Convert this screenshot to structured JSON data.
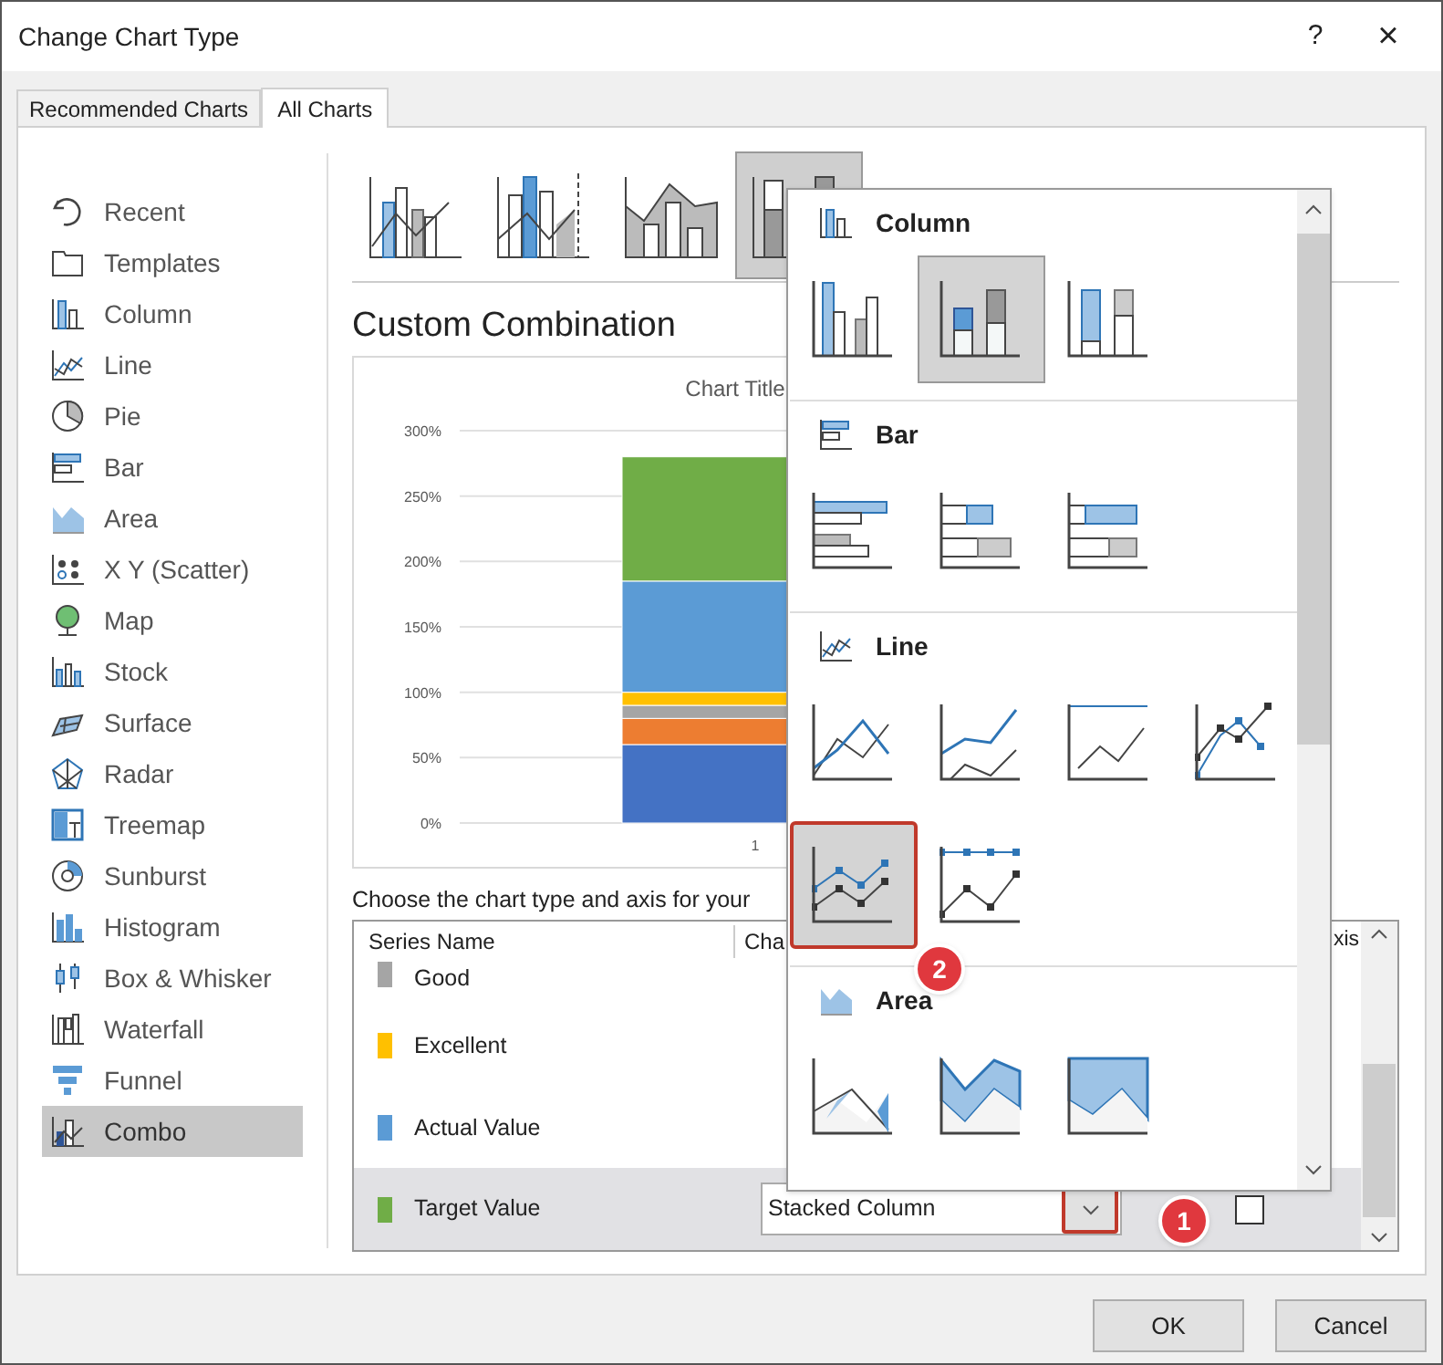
{
  "window": {
    "title": "Change Chart Type",
    "help": "?",
    "close": "×"
  },
  "tabs": [
    {
      "label": "Recommended Charts",
      "selected": false
    },
    {
      "label": "All Charts",
      "selected": true
    }
  ],
  "sidebar": {
    "items": [
      {
        "label": "Recent",
        "selected": false
      },
      {
        "label": "Templates",
        "selected": false
      },
      {
        "label": "Column",
        "selected": false
      },
      {
        "label": "Line",
        "selected": false
      },
      {
        "label": "Pie",
        "selected": false
      },
      {
        "label": "Bar",
        "selected": false
      },
      {
        "label": "Area",
        "selected": false
      },
      {
        "label": "X Y (Scatter)",
        "selected": false
      },
      {
        "label": "Map",
        "selected": false
      },
      {
        "label": "Stock",
        "selected": false
      },
      {
        "label": "Surface",
        "selected": false
      },
      {
        "label": "Radar",
        "selected": false
      },
      {
        "label": "Treemap",
        "selected": false
      },
      {
        "label": "Sunburst",
        "selected": false
      },
      {
        "label": "Histogram",
        "selected": false
      },
      {
        "label": "Box & Whisker",
        "selected": false
      },
      {
        "label": "Waterfall",
        "selected": false
      },
      {
        "label": "Funnel",
        "selected": false
      },
      {
        "label": "Combo",
        "selected": true
      }
    ]
  },
  "combo_types": [
    {
      "selected": false
    },
    {
      "selected": false
    },
    {
      "selected": false
    },
    {
      "selected": true
    }
  ],
  "heading": "Custom Combination",
  "preview": {
    "chart_data": {
      "type": "bar",
      "stacked": true,
      "title": "Chart Title",
      "categories": [
        "1"
      ],
      "ylim": [
        0,
        3
      ],
      "grid": true,
      "yticks": [
        {
          "value": 0,
          "label": "0%"
        },
        {
          "value": 0.5,
          "label": "50%"
        },
        {
          "value": 1,
          "label": "100%"
        },
        {
          "value": 1.5,
          "label": "150%"
        },
        {
          "value": 2,
          "label": "200%"
        },
        {
          "value": 2.5,
          "label": "250%"
        },
        {
          "value": 3,
          "label": "300%"
        }
      ],
      "series": [
        {
          "color": "#4472c4",
          "values": [
            0.6
          ]
        },
        {
          "color": "#ed7d31",
          "values": [
            0.2
          ]
        },
        {
          "color": "#a5a5a5",
          "values": [
            0.1
          ]
        },
        {
          "color": "#ffc000",
          "values": [
            0.1
          ]
        },
        {
          "color": "#5b9bd5",
          "values": [
            0.85
          ]
        },
        {
          "color": "#70ad47",
          "values": [
            0.95
          ]
        }
      ]
    }
  },
  "instruction": "Choose the chart type and axis for your",
  "series_table": {
    "columns": [
      "Series Name",
      "Cha",
      "xis"
    ],
    "rows": [
      {
        "name": "Good",
        "color": "#a5a5a5",
        "selected": false
      },
      {
        "name": "Excellent",
        "color": "#ffc000",
        "selected": false
      },
      {
        "name": "Actual Value",
        "color": "#5b9bd5",
        "selected": false
      },
      {
        "name": "Target Value",
        "color": "#70ad47",
        "selected": true
      }
    ],
    "chart_type_value": "Stacked Column",
    "dropdown_annotated": true,
    "secondary_axis_checked": false
  },
  "chart_type_menu": {
    "sections": [
      {
        "kind": "column",
        "title": "Column",
        "subtypes": [
          {
            "selected": false,
            "annotated": false
          },
          {
            "selected": true,
            "annotated": false
          },
          {
            "selected": false,
            "annotated": false
          }
        ]
      },
      {
        "kind": "bar",
        "title": "Bar",
        "subtypes": [
          {
            "selected": false,
            "annotated": false
          },
          {
            "selected": false,
            "annotated": false
          },
          {
            "selected": false,
            "annotated": false
          }
        ]
      },
      {
        "kind": "line",
        "title": "Line",
        "subtypes": [
          {
            "selected": false,
            "annotated": false
          },
          {
            "selected": false,
            "annotated": false
          },
          {
            "selected": false,
            "annotated": false
          },
          {
            "selected": false,
            "annotated": false
          },
          {
            "selected": true,
            "annotated": true
          },
          {
            "selected": false,
            "annotated": false
          }
        ]
      },
      {
        "kind": "area",
        "title": "Area",
        "subtypes": [
          {
            "selected": false,
            "annotated": false
          },
          {
            "selected": false,
            "annotated": false
          },
          {
            "selected": false,
            "annotated": false
          }
        ]
      }
    ]
  },
  "annotations": [
    "1",
    "2"
  ],
  "buttons": [
    "OK",
    "Cancel"
  ]
}
